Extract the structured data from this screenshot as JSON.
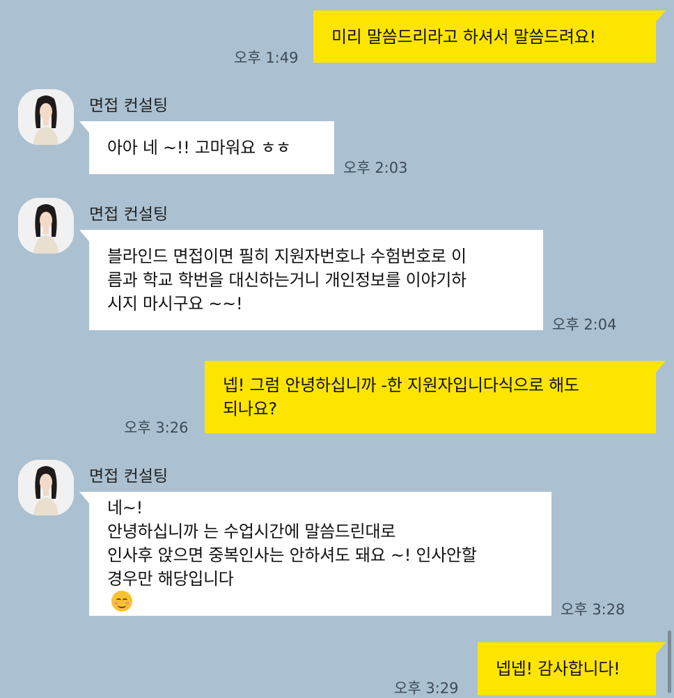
{
  "contact": {
    "name": "면접 컨설팅"
  },
  "messages": [
    {
      "from": "me",
      "lines": [
        "미리 말씀드리라고 하셔서 말씀드려요!"
      ],
      "time": "오후 1:49"
    },
    {
      "from": "other",
      "lines": [
        "아아 네 ~!! 고마워요 ㅎㅎ"
      ],
      "time": "오후 2:03"
    },
    {
      "from": "other",
      "lines": [
        "블라인드 면접이면 필히 지원자번호나 수험번호로 이",
        "름과 학교 학번을 대신하는거니 개인정보를 이야기하",
        "시지 마시구요 ~~!"
      ],
      "time": "오후 2:04"
    },
    {
      "from": "me",
      "lines": [
        "넵! 그럼 안녕하십니까 -한 지원자입니다식으로 해도",
        "되나요?"
      ],
      "time": "오후 3:26"
    },
    {
      "from": "other",
      "lines": [
        "네~!",
        "안녕하십니까 는 수업시간에 말씀드린대로",
        "인사후 앉으면 중복인사는 안하셔도 돼요 ~! 인사안할",
        "경우만 해당입니다"
      ],
      "time": "오후 3:28",
      "emoji": "smiling-face-emoji"
    },
    {
      "from": "me",
      "lines": [
        "넵넵! 감사합니다!"
      ],
      "time": "오후 3:29"
    }
  ],
  "colors": {
    "background": "#abc1d1",
    "my_bubble": "#fee500",
    "other_bubble": "#ffffff"
  }
}
